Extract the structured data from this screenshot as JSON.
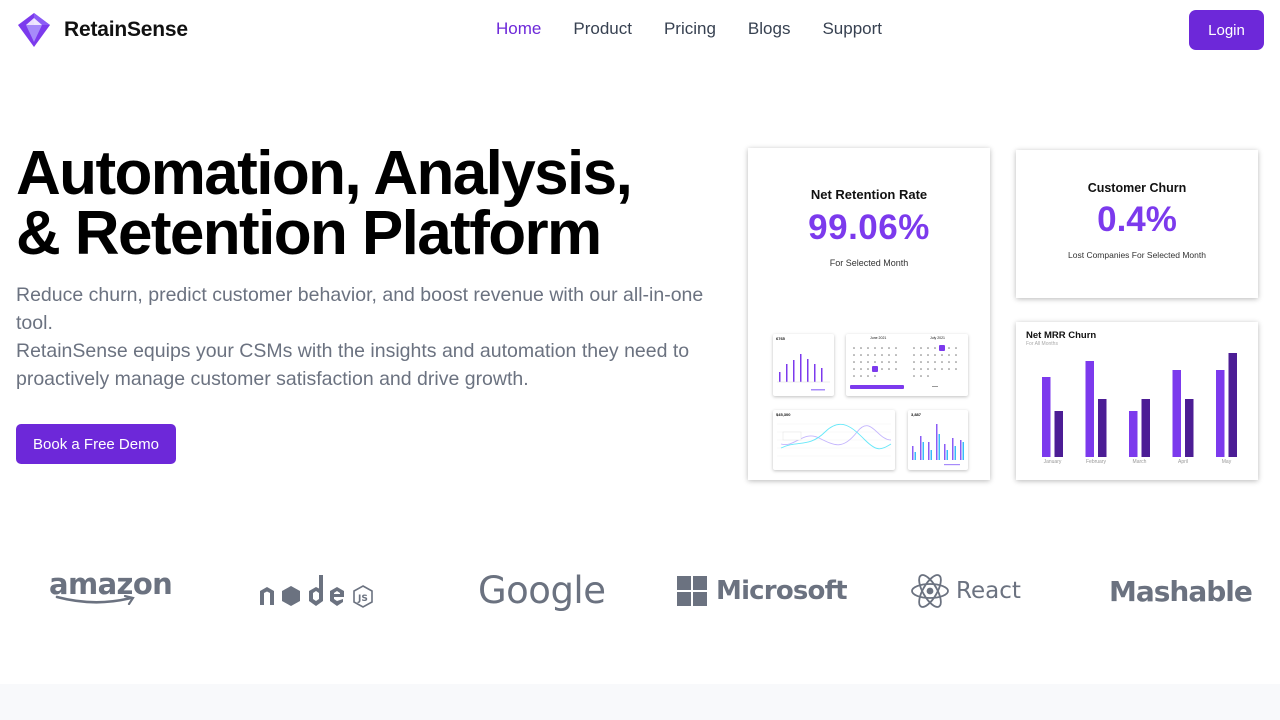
{
  "nav": {
    "brand": "RetainSense",
    "links": [
      "Home",
      "Product",
      "Pricing",
      "Blogs",
      "Support"
    ],
    "active": "Home",
    "login_label": "Login"
  },
  "hero": {
    "title_line1": "Automation, Analysis,",
    "title_line2": "& Retention Platform",
    "subtitle_line1": "Reduce churn, predict customer behavior, and boost revenue with our all-in-one tool.",
    "subtitle_line2": "RetainSense equips your CSMs with the insights and automation they need to proactively manage customer satisfaction and drive growth.",
    "cta_label": "Book a Free Demo"
  },
  "cards": {
    "net_retention": {
      "title": "Net Retention Rate",
      "value": "99.06%",
      "caption": "For Selected Month"
    },
    "customer_churn": {
      "title": "Customer Churn",
      "value": "0.4%",
      "caption": "Lost Companies For Selected Month"
    },
    "net_mrr_churn": {
      "title": "Net MRR Churn",
      "subtitle": "For All Months",
      "chart_data": {
        "type": "bar",
        "categories": [
          "January",
          "February",
          "March",
          "April",
          "May"
        ],
        "series": [
          {
            "values": [
              80,
              96,
              46,
              87,
              87
            ]
          },
          {
            "values": [
              46,
              58,
              58,
              58,
              104
            ]
          }
        ],
        "ylim": [
          0,
          110
        ]
      }
    }
  },
  "mini_widgets": {
    "widget_a_value": "6765",
    "widget_c_value": "$45,300",
    "widget_d_value": "3,887",
    "calendar_left": "June 2021",
    "calendar_right": "July 2021"
  },
  "partners": [
    "amazon",
    "node",
    "Google",
    "Microsoft",
    "React",
    "Mashable"
  ],
  "colors": {
    "brand": "#6d28d9",
    "accent": "#7c3aed",
    "dark_bar": "#4c1d95",
    "muted": "#6b7280"
  }
}
